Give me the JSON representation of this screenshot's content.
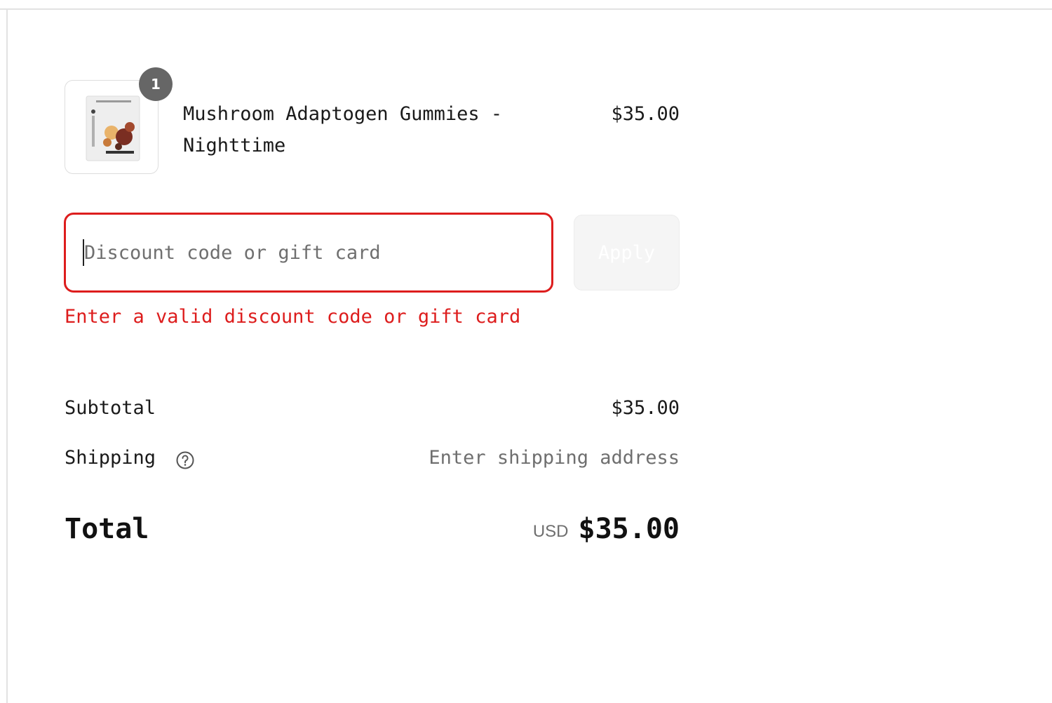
{
  "order_summary": {
    "line_item": {
      "quantity_badge": "1",
      "title": "Mushroom Adaptogen Gummies - Nighttime",
      "price": "$35.00",
      "image_icon": "product-image"
    },
    "discount": {
      "placeholder": "Discount code or gift card",
      "value": "",
      "apply_label": "Apply",
      "error": "Enter a valid discount code or gift card"
    },
    "subtotal": {
      "label": "Subtotal",
      "value": "$35.00"
    },
    "shipping": {
      "label": "Shipping",
      "value": "Enter shipping address",
      "help_icon": "question-circle-icon"
    },
    "total": {
      "label": "Total",
      "currency": "USD",
      "value": "$35.00"
    }
  },
  "colors": {
    "error": "#dd1d1d",
    "badge": "#666666",
    "muted_text": "#6f6f6f"
  }
}
